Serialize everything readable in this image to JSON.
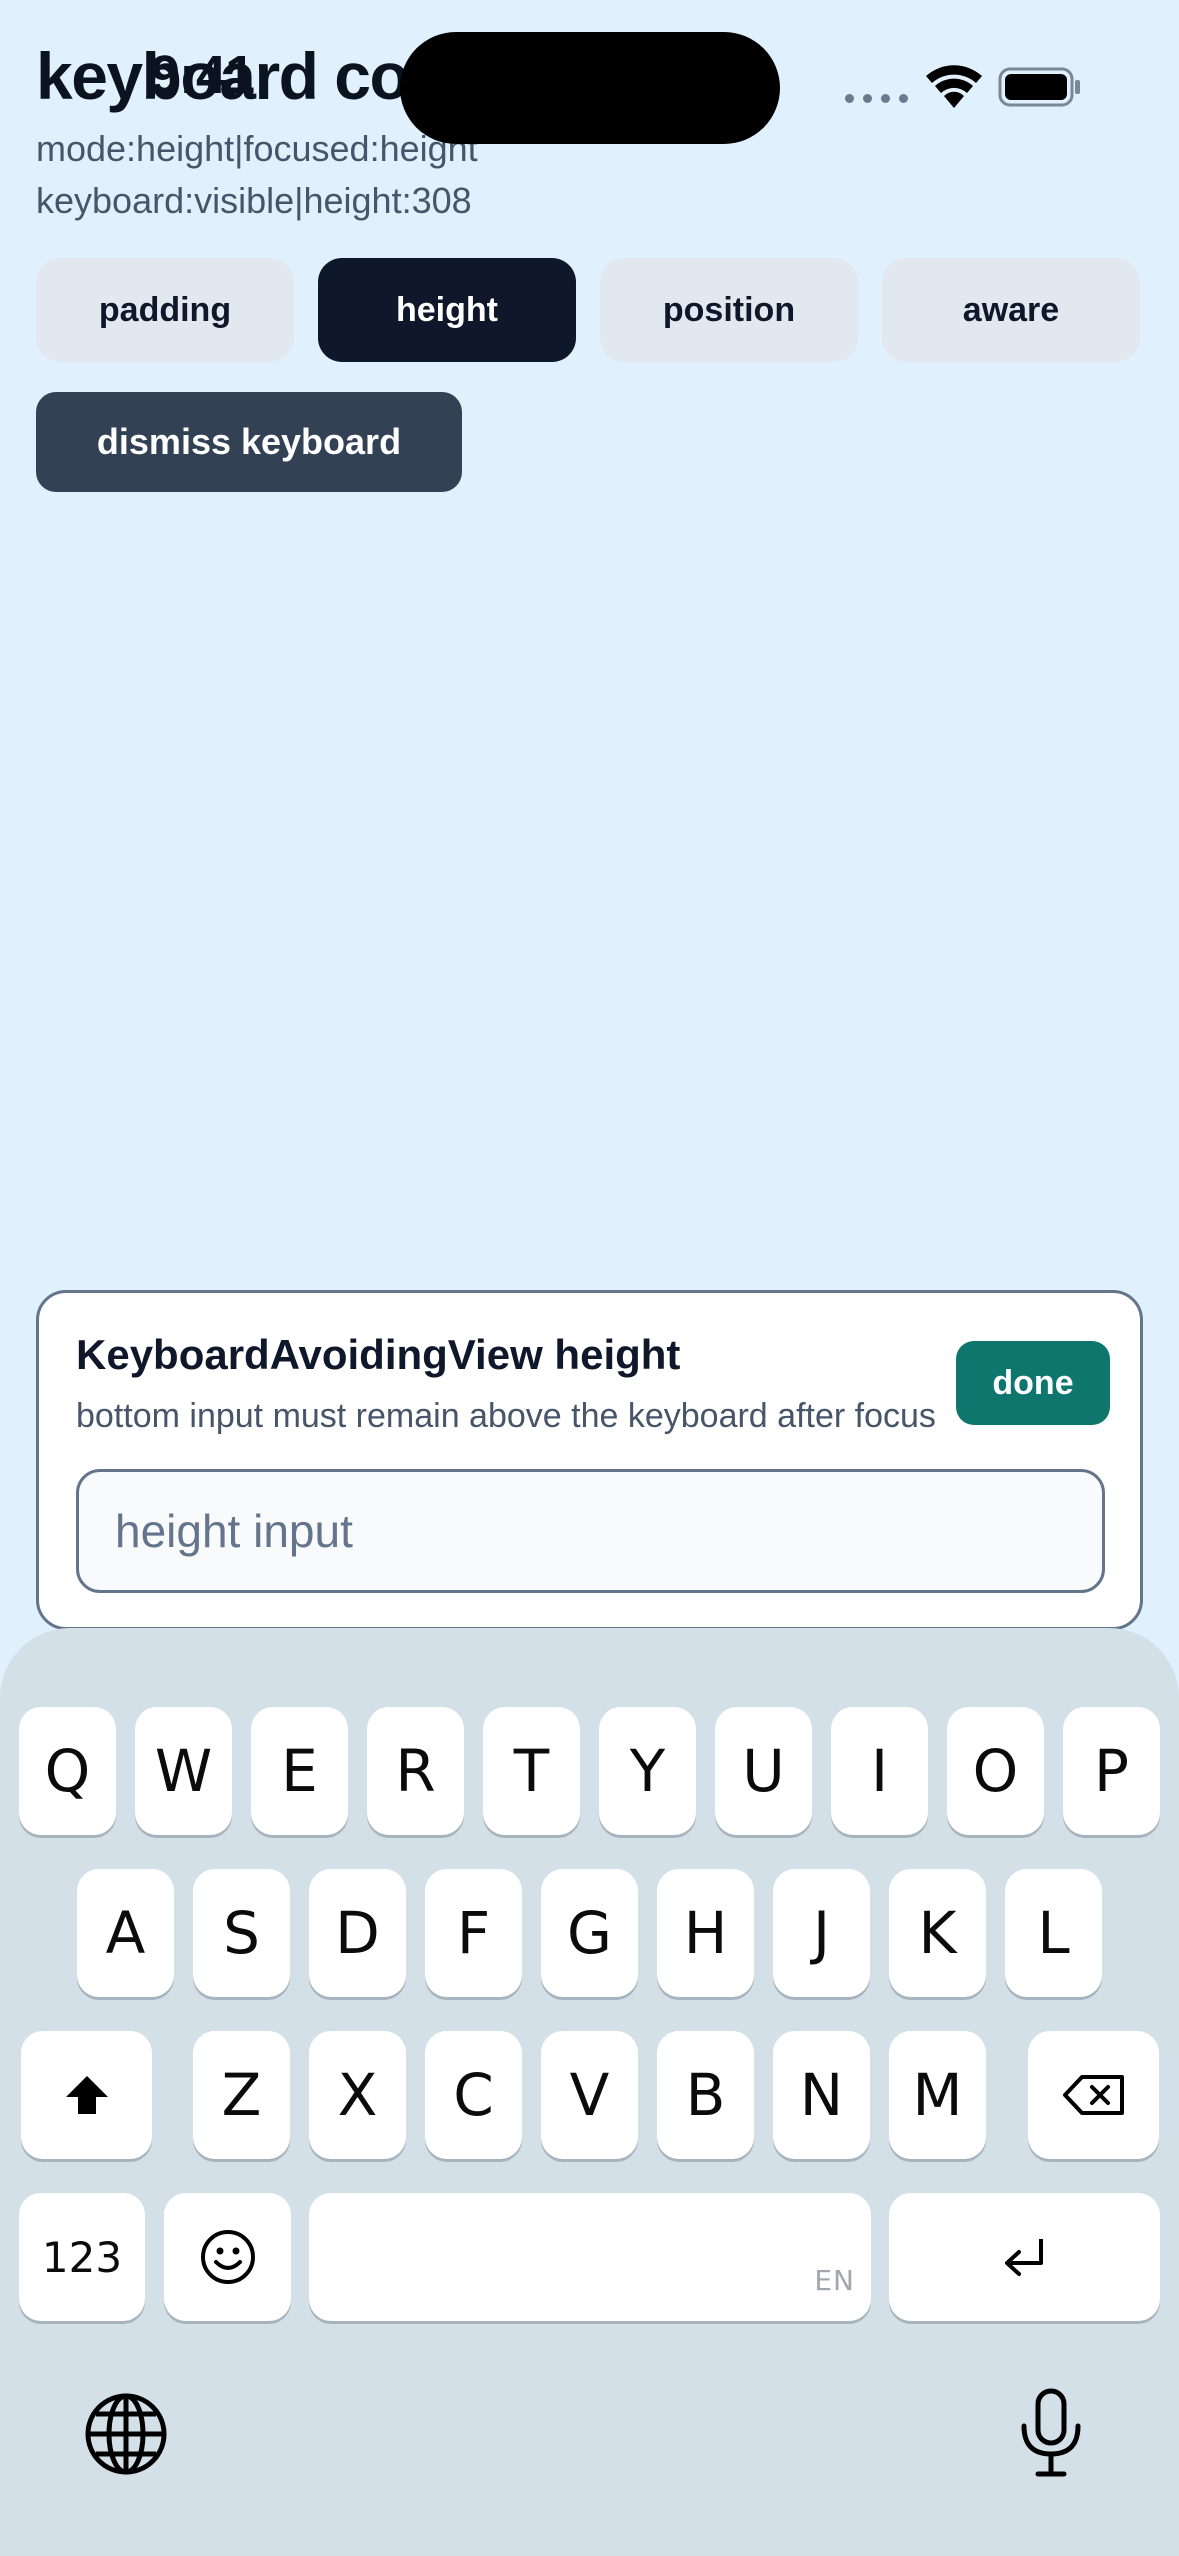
{
  "status_bar": {
    "time": "9:41"
  },
  "header": {
    "title": "keyboard co",
    "info_mode": "mode:height|focused:height",
    "info_keyboard": "keyboard:visible|height:308"
  },
  "modes": [
    {
      "label": "padding",
      "active": false
    },
    {
      "label": "height",
      "active": true
    },
    {
      "label": "position",
      "active": false
    },
    {
      "label": "aware",
      "active": false
    }
  ],
  "dismiss_label": "dismiss keyboard",
  "card": {
    "title": "KeyboardAvoidingView height",
    "subtitle": "bottom input must remain above the keyboard after focus",
    "done_label": "done",
    "input_placeholder": "height input"
  },
  "keyboard": {
    "row1": [
      "Q",
      "W",
      "E",
      "R",
      "T",
      "Y",
      "U",
      "I",
      "O",
      "P"
    ],
    "row2": [
      "A",
      "S",
      "D",
      "F",
      "G",
      "H",
      "J",
      "K",
      "L"
    ],
    "row3": [
      "Z",
      "X",
      "C",
      "V",
      "B",
      "N",
      "M"
    ],
    "numbers_label": "123",
    "space_language": "EN"
  },
  "icons": {
    "status": [
      "signal-dots-icon",
      "wifi-icon",
      "battery-icon"
    ],
    "keyboard": [
      "shift-icon",
      "backspace-icon",
      "emoji-icon",
      "return-icon",
      "globe-icon",
      "microphone-icon"
    ]
  },
  "colors": {
    "background": "#e0f0fd",
    "active_mode": "#0f172a",
    "dismiss": "#334155",
    "done": "#0f766e",
    "keyboard": "#d3e0e8"
  }
}
